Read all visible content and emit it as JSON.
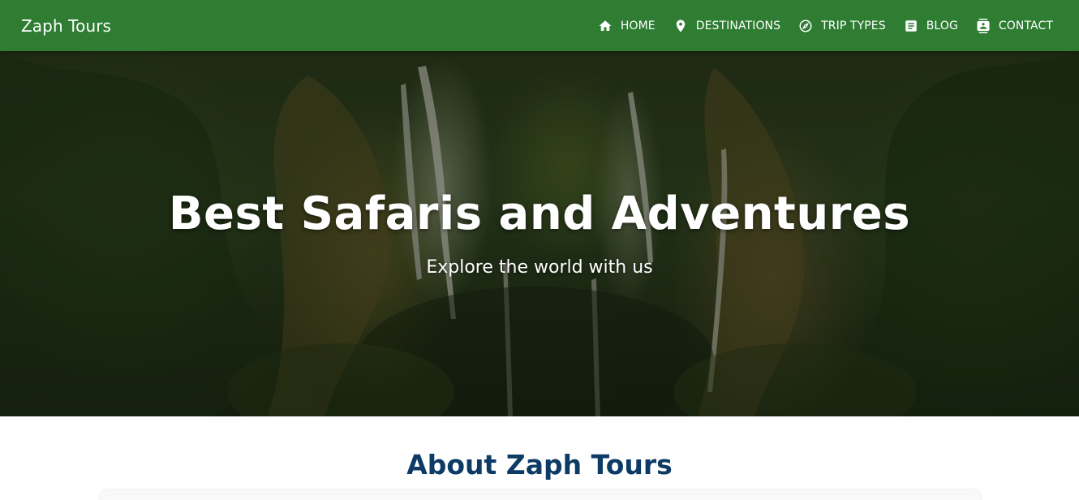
{
  "navbar": {
    "brand": "Zaph Tours",
    "background_color": "#2e7d32",
    "items": [
      {
        "label": "HOME",
        "icon": "home-icon"
      },
      {
        "label": "DESTINATIONS",
        "icon": "location-pin-icon"
      },
      {
        "label": "TRIP TYPES",
        "icon": "compass-icon"
      },
      {
        "label": "BLOG",
        "icon": "article-icon"
      },
      {
        "label": "CONTACT",
        "icon": "contact-card-icon"
      }
    ]
  },
  "hero": {
    "title": "Best Safaris and Adventures",
    "subtitle": "Explore the world with us",
    "background_image": "waterfall-forest-photo"
  },
  "about": {
    "heading": "About Zaph Tours",
    "heading_color": "#0d3b66"
  }
}
